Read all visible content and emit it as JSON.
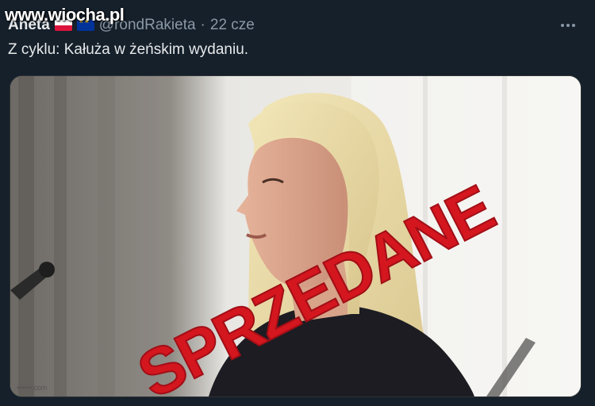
{
  "watermark": "www.wiocha.pl",
  "tweet": {
    "display_name": "Aneta",
    "badges": [
      "flag-pl-icon",
      "flag-eu-icon"
    ],
    "handle": "@rondRakieta",
    "separator": "·",
    "timestamp": "22 cze",
    "text": "Z cyklu: Kałuża w żeńskim wydaniu.",
    "more_icon": "more-horizontal-icon"
  },
  "media": {
    "stamp_text": "SPRZEDANE",
    "stamp_color": "#d4161f",
    "corner_credit": "••••••.com"
  },
  "colors": {
    "background": "#15202b",
    "text": "#e7e9ea",
    "muted": "#8b98a5"
  }
}
